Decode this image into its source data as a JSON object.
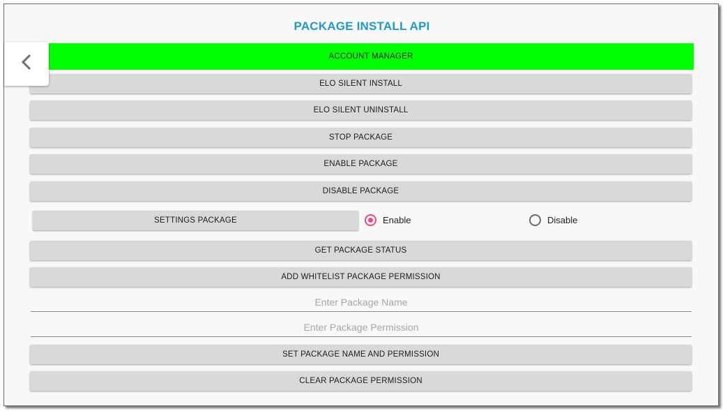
{
  "title": "PACKAGE INSTALL API",
  "back_icon": "chevron-left-icon",
  "buttons": {
    "account_manager": "ACCOUNT MANAGER",
    "silent_install": "ELO SILENT INSTALL",
    "silent_uninstall": "ELO SILENT UNINSTALL",
    "stop_package": "STOP PACKAGE",
    "enable_package": "ENABLE PACKAGE",
    "disable_package": "DISABLE PACKAGE",
    "settings_package": "SETTINGS PACKAGE",
    "get_status": "GET PACKAGE STATUS",
    "add_whitelist": "ADD WHITELIST PACKAGE PERMISSION",
    "set_name_permission": "SET PACKAGE NAME AND PERMISSION",
    "clear_permission": "CLEAR PACKAGE PERMISSION"
  },
  "radio": {
    "enable_label": "Enable",
    "disable_label": "Disable",
    "selected": "Enable"
  },
  "inputs": {
    "package_name": {
      "value": "",
      "placeholder": "Enter Package Name"
    },
    "package_permission": {
      "value": "",
      "placeholder": "Enter Package Permission"
    }
  },
  "colors": {
    "title": "#1e9bc9",
    "highlight": "#00ff00",
    "radio_accent": "#e94a7d",
    "button_bg": "#d9d9d9"
  }
}
